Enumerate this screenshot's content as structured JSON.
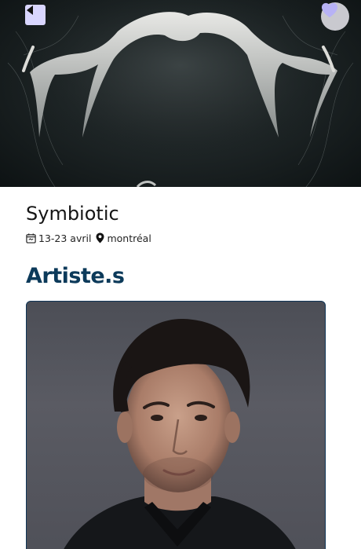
{
  "event": {
    "title": "Symbiotic",
    "dates": "13-23 avril",
    "location": "montréal"
  },
  "sections": {
    "artists_title": "Artiste.s"
  },
  "icons": {
    "back": "back-arrow-icon",
    "favorite": "heart-icon",
    "calendar": "calendar-icon",
    "location": "map-pin-icon"
  },
  "colors": {
    "section_title": "#0c3a5a",
    "back_button_bg": "#d9d6ff",
    "favorite_button_bg": "#c9c9cf",
    "favorite_heart": "#b7b2f5",
    "card_border": "#0f3557"
  }
}
